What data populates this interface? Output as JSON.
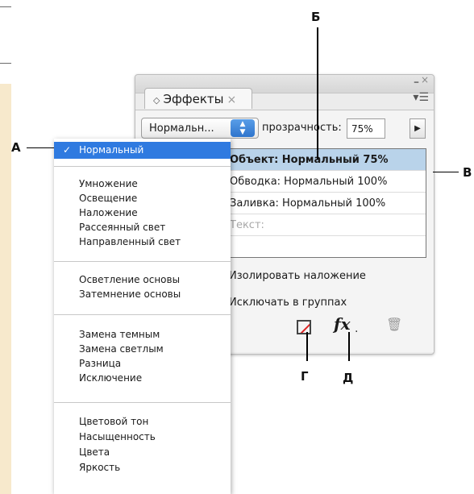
{
  "callouts": {
    "a": "А",
    "b": "Б",
    "v": "В",
    "g": "Г",
    "d": "Д"
  },
  "panel": {
    "tab_title": "Эффекты",
    "tab_close": "×",
    "blend_mode_value": "Нормальн...",
    "opacity_label": "прозрачность:",
    "opacity_value": "75%",
    "effects_rows": [
      "Объект: Нормальный 75%",
      "Обводка: Нормальный 100%",
      "Заливка: Нормальный 100%",
      "Текст:"
    ],
    "option_rows": [
      "Изолировать наложение",
      "Исключать в группах"
    ],
    "accent_color": "#b9d3ea"
  },
  "blend_menu": {
    "selected": "Нормальный",
    "groups": [
      [
        "Умножение",
        "Освещение",
        "Наложение",
        "Рассеянный свет",
        "Направленный свет"
      ],
      [
        "Осветление основы",
        "Затемнение основы"
      ],
      [
        "Замена темным",
        "Замена светлым",
        "Разница",
        "Исключение"
      ],
      [
        "Цветовой тон",
        "Насыщенность",
        "Цвета",
        "Яркость"
      ]
    ],
    "highlight_color": "#2f7ae0"
  },
  "sidebar": {
    "color": "#f7e9cc"
  }
}
